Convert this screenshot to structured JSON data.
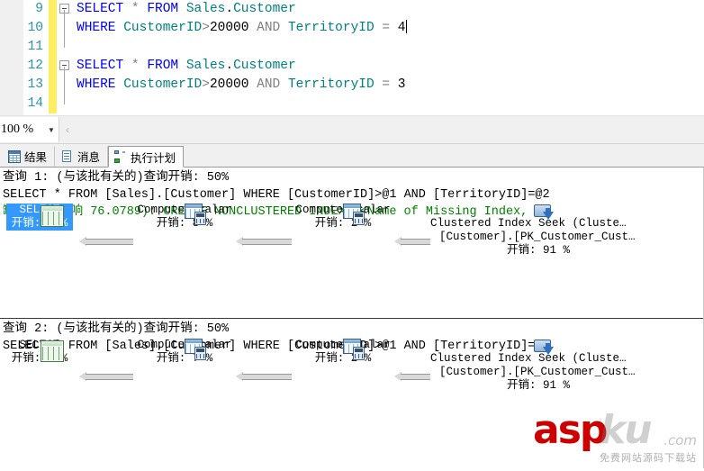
{
  "editor": {
    "lines": [
      {
        "num": "9",
        "fold": "start",
        "text_html": "kw:SELECT| |op:*| |kw:FROM| |id:Sales|pl:.|id:Customer"
      },
      {
        "num": "10",
        "fold": "mid",
        "text_html": "kw:WHERE| |id:CustomerID|op:>|num:20000| |kw2:AND| |id:TerritoryID| |op:=| |num:4"
      },
      {
        "num": "11",
        "fold": "mid",
        "text_html": ""
      },
      {
        "num": "12",
        "fold": "start",
        "text_html": "kw:SELECT| |op:*| |kw:FROM| |id:Sales|pl:.|id:Customer"
      },
      {
        "num": "13",
        "fold": "mid",
        "text_html": "kw:WHERE| |id:CustomerID|op:>|num:20000| |kw2:AND| |id:TerritoryID| |op:=| |num:3"
      },
      {
        "num": "14",
        "fold": "end",
        "text_html": ""
      }
    ],
    "line_9": "SELECT * FROM Sales.Customer",
    "line_10": "WHERE CustomerID>20000 AND TerritoryID = 4",
    "line_11": "",
    "line_12": "SELECT * FROM Sales.Customer",
    "line_13": "WHERE CustomerID>20000 AND TerritoryID = 3",
    "line_14": "",
    "ln_9": "9",
    "ln_10": "10",
    "ln_11": "11",
    "ln_12": "12",
    "ln_13": "13",
    "ln_14": "14"
  },
  "zoombar": {
    "zoom_value": "100 %",
    "dropdown_glyph": "▼",
    "scroll_left_glyph": "‹"
  },
  "tabs": [
    {
      "label": "结果",
      "icon": "grid-icon",
      "active": false
    },
    {
      "label": "消息",
      "icon": "message-icon",
      "active": false
    },
    {
      "label": "执行计划",
      "icon": "plan-icon",
      "active": true
    }
  ],
  "plans": [
    {
      "header": "查询 1: (与该批有关的)查询开销: 50%",
      "sql": "SELECT * FROM [Sales].[Customer] WHERE [CustomerID]>@1 AND [TerritoryID]=@2",
      "missing_index": "缺少索引(影响 76.0789): CREATE NONCLUSTERED INDEX [<Name of Missing Index, s",
      "nodes": [
        {
          "icon": "select-result-icon",
          "label": "SELECT",
          "label2": "",
          "cost": "开销: 0 %",
          "selected": true
        },
        {
          "icon": "compute-scalar-icon",
          "label": "Compute Scalar",
          "label2": "",
          "cost": "开销: 8 %",
          "selected": false
        },
        {
          "icon": "compute-scalar-icon",
          "label": "Compute Scalar",
          "label2": "",
          "cost": "开销: 2 %",
          "selected": false
        },
        {
          "icon": "index-seek-icon",
          "label": "Clustered Index Seek (Cluste…",
          "label2": "[Customer].[PK_Customer_Cust…",
          "cost": "开销: 91 %",
          "selected": false
        }
      ]
    },
    {
      "header": "查询 2: (与该批有关的)查询开销: 50%",
      "sql": "SELECT * FROM [Sales].[Customer] WHERE [CustomerID]>@1 AND [TerritoryID]=@2",
      "missing_index": "",
      "nodes": [
        {
          "icon": "select-result-icon",
          "label": "SELECT",
          "label2": "",
          "cost": "开销: 0 %",
          "selected": false
        },
        {
          "icon": "compute-scalar-icon",
          "label": "Compute Scalar",
          "label2": "",
          "cost": "开销: 7 %",
          "selected": false
        },
        {
          "icon": "compute-scalar-icon",
          "label": "Compute Scalar",
          "label2": "",
          "cost": "开销: 2 %",
          "selected": false
        },
        {
          "icon": "index-seek-icon",
          "label": "Clustered Index Seek (Cluste…",
          "label2": "[Customer].[PK_Customer_Cust…",
          "cost": "开销: 91 %",
          "selected": false
        }
      ]
    }
  ],
  "watermark": {
    "primary": "asp",
    "secondary": "ku",
    "tld": ".com",
    "subtitle": "免费网站源码下载站"
  },
  "colors": {
    "keyword": "#0000ff",
    "identifier": "#008080",
    "operator": "#808080",
    "missing_index": "#008000",
    "selection": "#3399ff",
    "changebar": "#ffee62"
  }
}
